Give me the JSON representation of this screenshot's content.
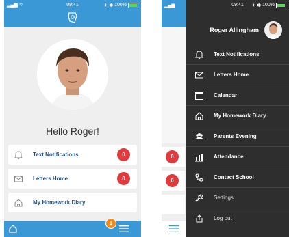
{
  "left_screen": {
    "status": {
      "time": "09:41",
      "battery": "100%"
    },
    "greeting": "Hello Roger!",
    "cards": [
      {
        "label": "Text Notifications",
        "badge": "0"
      },
      {
        "label": "Letters Home",
        "badge": "0"
      },
      {
        "label": "My Homework Diary"
      }
    ],
    "menu_badge": "1",
    "icons": {
      "logo": "school-logo-icon",
      "home": "home-icon",
      "menu": "hamburger-menu-icon"
    }
  },
  "right_screen": {
    "status": {
      "time": "09:41",
      "battery": "100%"
    },
    "user_name": "Roger Allingham",
    "background_badges": [
      "0",
      "0"
    ],
    "menu": [
      {
        "label": "Text Notifications",
        "icon": "bell-icon"
      },
      {
        "label": "Letters Home",
        "icon": "envelope-icon"
      },
      {
        "label": "Calendar",
        "icon": "calendar-icon"
      },
      {
        "label": "My Homework Diary",
        "icon": "home-icon"
      },
      {
        "label": "Parents Evening",
        "icon": "people-icon"
      },
      {
        "label": "Attendance",
        "icon": "bar-chart-icon"
      },
      {
        "label": "Contact School",
        "icon": "phone-icon"
      },
      {
        "label": "Settings",
        "icon": "wrench-icon"
      },
      {
        "label": "Log out",
        "icon": "logout-icon"
      }
    ]
  },
  "colors": {
    "primary_blue": "#3a98d6",
    "badge_red": "#e2393c",
    "badge_orange": "#f18a1c",
    "drawer_bg": "#2e2e2e",
    "label_blue": "#1f4f84"
  }
}
